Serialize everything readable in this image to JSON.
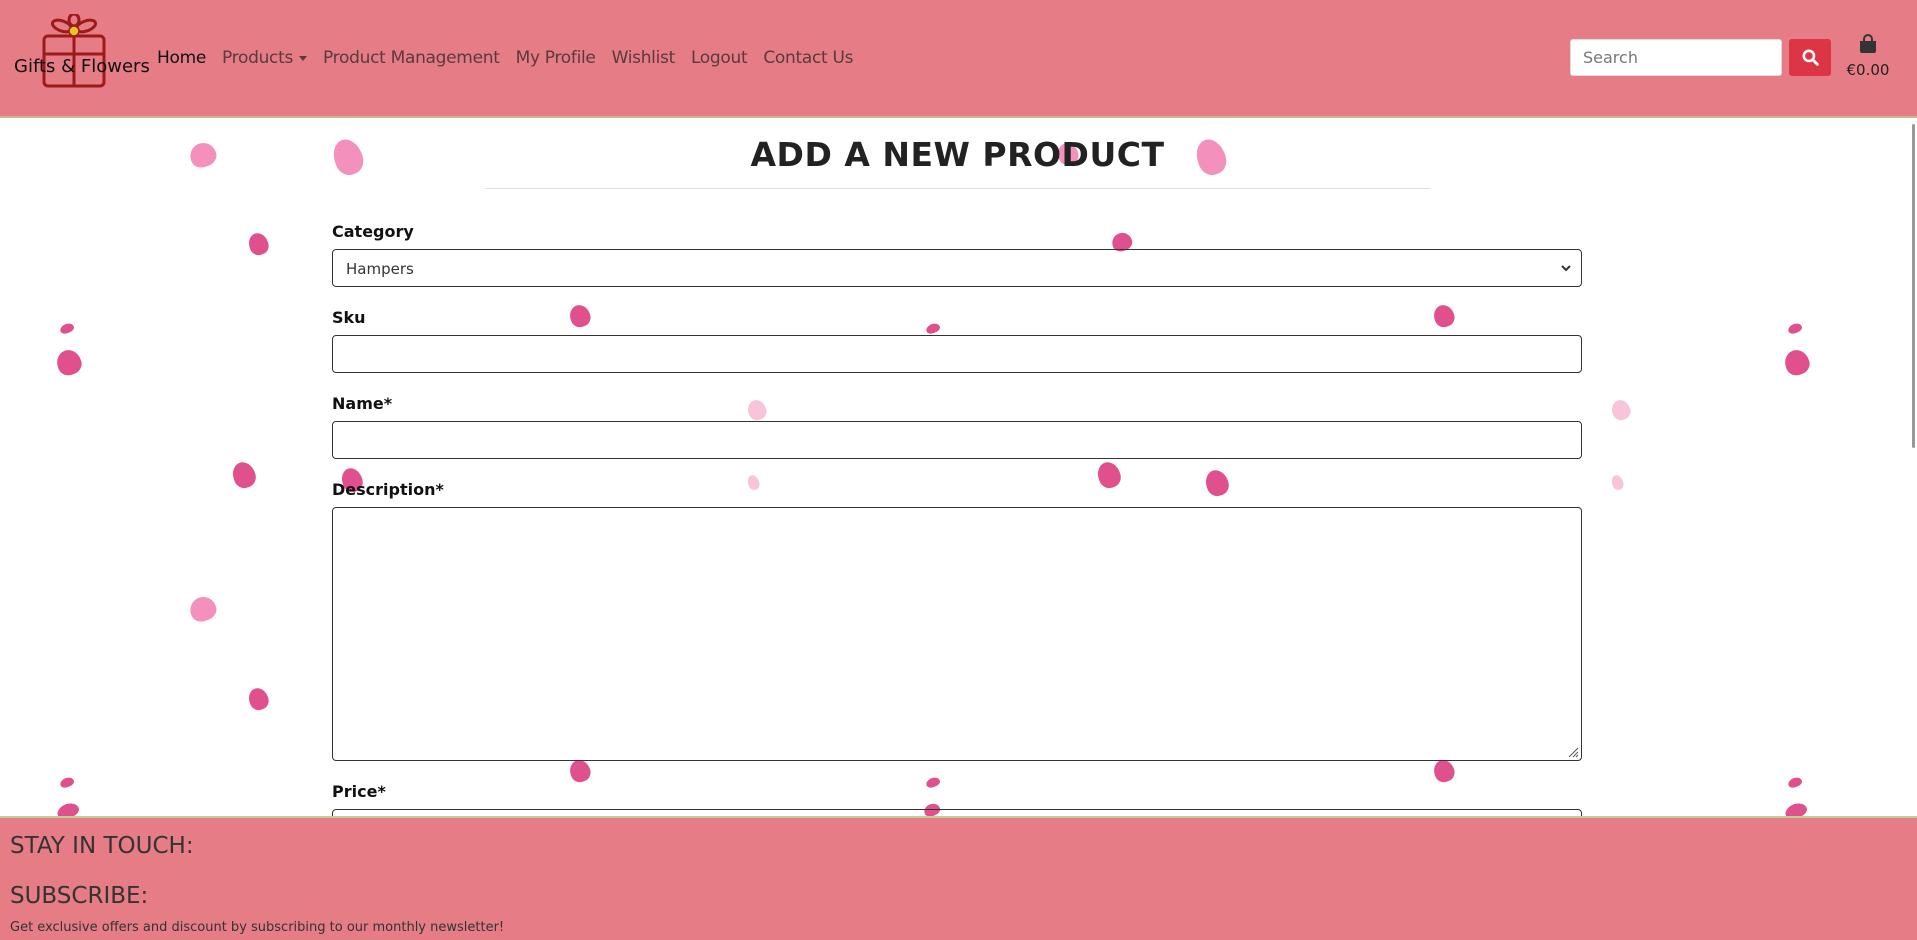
{
  "brand": {
    "name": "Gifts & Flowers",
    "logo_icon": "gift-box-flower-icon"
  },
  "nav": {
    "items": [
      {
        "label": "Home",
        "active": true
      },
      {
        "label": "Products",
        "dropdown": true
      },
      {
        "label": "Product Management"
      },
      {
        "label": "My Profile"
      },
      {
        "label": "Wishlist"
      },
      {
        "label": "Logout"
      },
      {
        "label": "Contact Us"
      }
    ]
  },
  "search": {
    "placeholder": "Search",
    "button_icon": "search-icon"
  },
  "cart": {
    "icon": "shopping-bag-icon",
    "amount": "€0.00"
  },
  "main": {
    "title": "ADD A NEW PRODUCT",
    "fields": {
      "category": {
        "label": "Category",
        "value": "Hampers"
      },
      "sku": {
        "label": "Sku",
        "value": ""
      },
      "name": {
        "label": "Name*",
        "value": ""
      },
      "description": {
        "label": "Description*",
        "value": ""
      },
      "price": {
        "label": "Price*",
        "value": ""
      }
    }
  },
  "footer": {
    "stay_in_touch": "STAY IN TOUCH:",
    "subscribe": "SUBSCRIBE:",
    "newsletter_text": "Get exclusive offers and discount by subscribing to our monthly newsletter!"
  },
  "colors": {
    "header_bg": "#e67c85",
    "search_button": "#dc3545",
    "petal_dark": "#e0508c",
    "petal_light": "#f490bc",
    "petal_pale": "#f7c4da"
  }
}
